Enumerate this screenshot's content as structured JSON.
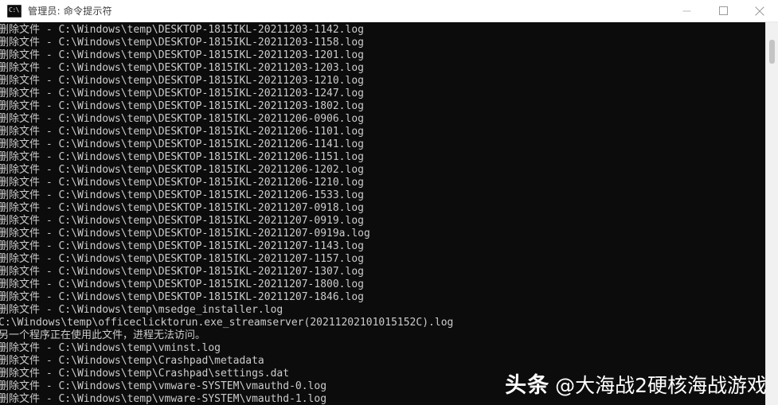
{
  "window": {
    "title": "管理员: 命令提示符",
    "icon": "command-prompt-icon",
    "icon_glyph": "C:\\.",
    "controls": {
      "minimize": "最小化",
      "maximize": "最大化",
      "close": "关闭"
    },
    "titlebar_bg": "#ffffff",
    "titlebar_fg": "#3c3c3c"
  },
  "console": {
    "bg": "#0c0c0c",
    "fg": "#cccccc",
    "lines": [
      "删除文件 - C:\\Windows\\temp\\DESKTOP-1815IKL-20211203-1142.log",
      "删除文件 - C:\\Windows\\temp\\DESKTOP-1815IKL-20211203-1158.log",
      "删除文件 - C:\\Windows\\temp\\DESKTOP-1815IKL-20211203-1201.log",
      "删除文件 - C:\\Windows\\temp\\DESKTOP-1815IKL-20211203-1203.log",
      "删除文件 - C:\\Windows\\temp\\DESKTOP-1815IKL-20211203-1210.log",
      "删除文件 - C:\\Windows\\temp\\DESKTOP-1815IKL-20211203-1247.log",
      "删除文件 - C:\\Windows\\temp\\DESKTOP-1815IKL-20211203-1802.log",
      "删除文件 - C:\\Windows\\temp\\DESKTOP-1815IKL-20211206-0906.log",
      "删除文件 - C:\\Windows\\temp\\DESKTOP-1815IKL-20211206-1101.log",
      "删除文件 - C:\\Windows\\temp\\DESKTOP-1815IKL-20211206-1141.log",
      "删除文件 - C:\\Windows\\temp\\DESKTOP-1815IKL-20211206-1151.log",
      "删除文件 - C:\\Windows\\temp\\DESKTOP-1815IKL-20211206-1202.log",
      "删除文件 - C:\\Windows\\temp\\DESKTOP-1815IKL-20211206-1210.log",
      "删除文件 - C:\\Windows\\temp\\DESKTOP-1815IKL-20211206-1533.log",
      "删除文件 - C:\\Windows\\temp\\DESKTOP-1815IKL-20211207-0918.log",
      "删除文件 - C:\\Windows\\temp\\DESKTOP-1815IKL-20211207-0919.log",
      "删除文件 - C:\\Windows\\temp\\DESKTOP-1815IKL-20211207-0919a.log",
      "删除文件 - C:\\Windows\\temp\\DESKTOP-1815IKL-20211207-1143.log",
      "删除文件 - C:\\Windows\\temp\\DESKTOP-1815IKL-20211207-1157.log",
      "删除文件 - C:\\Windows\\temp\\DESKTOP-1815IKL-20211207-1307.log",
      "删除文件 - C:\\Windows\\temp\\DESKTOP-1815IKL-20211207-1800.log",
      "删除文件 - C:\\Windows\\temp\\DESKTOP-1815IKL-20211207-1846.log",
      "删除文件 - C:\\Windows\\temp\\msedge_installer.log",
      "C:\\Windows\\temp\\officeclicktorun.exe_streamserver(20211202101015152C).log",
      "另一个程序正在使用此文件，进程无法访问。",
      "删除文件 - C:\\Windows\\temp\\vminst.log",
      "删除文件 - C:\\Windows\\temp\\Crashpad\\metadata",
      "删除文件 - C:\\Windows\\temp\\Crashpad\\settings.dat",
      "删除文件 - C:\\Windows\\temp\\vmware-SYSTEM\\vmauthd-0.log",
      "删除文件 - C:\\Windows\\temp\\vmware-SYSTEM\\vmauthd-1.log"
    ]
  },
  "scrollbar": {
    "track_color": "#f1f1f1",
    "thumb_color": "#c4c4c4"
  },
  "watermark": {
    "brand": "头条",
    "handle": "@大海战2硬核海战游戏",
    "color": "#ffffff"
  }
}
